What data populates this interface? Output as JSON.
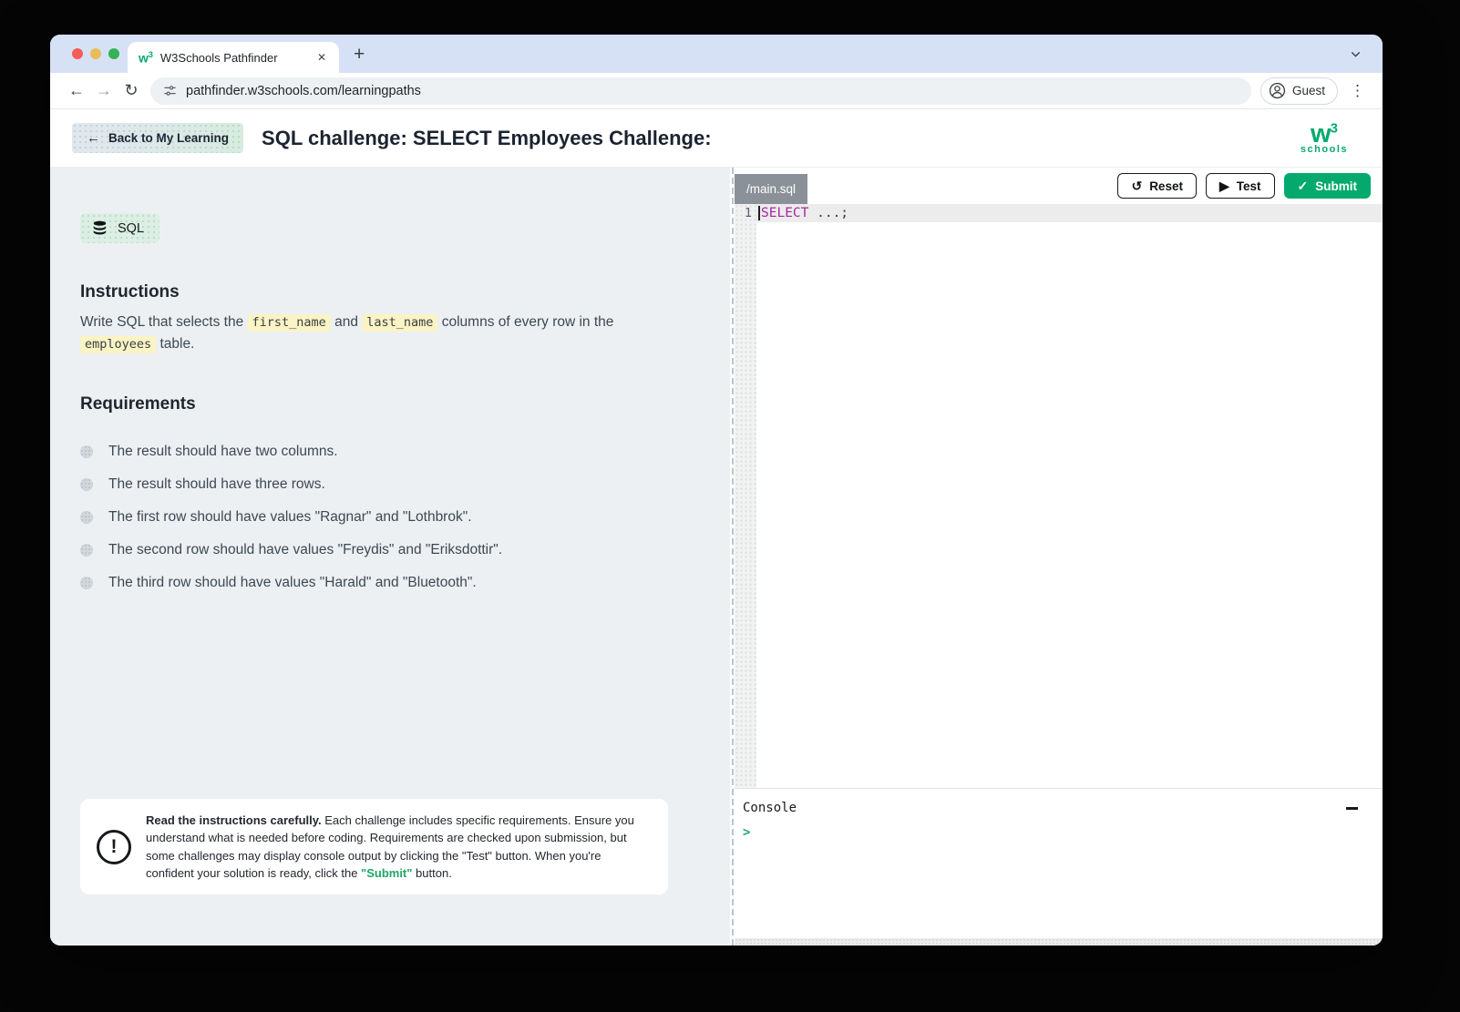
{
  "colors": {
    "brand_green": "#04AA6D",
    "submit_green": "#04AA6D",
    "keyword_purple": "#a626a4",
    "console_prompt_green": "#21a567",
    "code_highlight_bg": "#faf3c4",
    "tabstrip_bg": "#d7e1f6",
    "left_panel_bg": "#edf0f3",
    "file_tab_bg": "#8a9199"
  },
  "icons": {
    "back": "←",
    "forward": "→",
    "reload": "↻",
    "kebab": "⋮",
    "plus": "+",
    "close": "✕",
    "reset": "↺",
    "play": "▶",
    "check": "✓",
    "exclamation": "!",
    "back_arrow": "←"
  },
  "browser": {
    "tab": {
      "title": "W3Schools Pathfinder"
    },
    "favicon": {
      "w": "w",
      "sup": "3"
    },
    "url": "pathfinder.w3schools.com/learningpaths",
    "profile_label": "Guest"
  },
  "header": {
    "back_button": "Back to My Learning",
    "title": "SQL challenge: SELECT Employees Challenge:",
    "logo": {
      "w": "w",
      "sup": "3",
      "sub": "schools"
    }
  },
  "challenge": {
    "language_badge": "SQL",
    "instructions": {
      "heading": "Instructions",
      "t1": "Write SQL that selects the ",
      "c1": "first_name",
      "t2": " and ",
      "c2": "last_name",
      "t3": " columns of every row in the ",
      "c3": "employees",
      "t4": " table."
    },
    "requirements": {
      "heading": "Requirements",
      "items": [
        "The result should have two columns.",
        "The result should have three rows.",
        "The first row should have values \"Ragnar\" and \"Lothbrok\".",
        "The second row should have values \"Freydis\" and \"Eriksdottir\".",
        "The third row should have values \"Harald\" and \"Bluetooth\"."
      ]
    },
    "note": {
      "bold": "Read the instructions carefully.",
      "body1": " Each challenge includes specific requirements. Ensure you understand what is needed before coding. Requirements are checked upon submission, but some challenges may display console output by clicking the \"Test\" button. When you're confident your solution is ready, click the ",
      "submit": "\"Submit\"",
      "body2": " button."
    }
  },
  "editor": {
    "file_tab": "/main.sql",
    "buttons": {
      "reset": "Reset",
      "test": "Test",
      "submit": "Submit"
    },
    "line_number": "1",
    "code": {
      "keyword": "SELECT",
      "rest": " ...;"
    }
  },
  "console": {
    "title": "Console",
    "prompt": ">"
  }
}
